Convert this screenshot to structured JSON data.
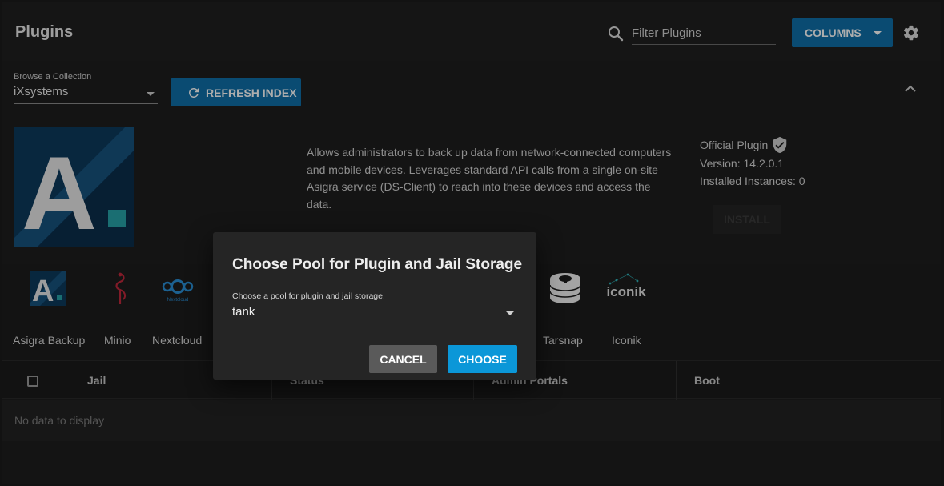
{
  "header": {
    "title": "Plugins",
    "filter_placeholder": "Filter Plugins",
    "columns_label": "COLUMNS"
  },
  "collection": {
    "label": "Browse a Collection",
    "value": "iXsystems",
    "refresh_label": "REFRESH INDEX"
  },
  "selected_plugin": {
    "description": "Allows administrators to back up data from network-connected computers and mobile devices. Leverages standard API calls from a single on-site Asigra service (DS-Client) to reach into these devices and access the data.",
    "official_label": "Official Plugin",
    "version": "Version: 14.2.0.1",
    "installed_instances": "Installed Instances: 0",
    "install_label": "INSTALL",
    "logo_letter": "A."
  },
  "plugins": [
    {
      "name": "Asigra Backup",
      "icon": "asigra-icon",
      "thumb_text": "A."
    },
    {
      "name": "Minio",
      "icon": "minio-icon",
      "thumb_text": ""
    },
    {
      "name": "Nextcloud",
      "icon": "nextcloud-icon",
      "thumb_text": "Nextcloud"
    },
    {
      "name": "Tarsnap",
      "icon": "tarsnap-icon",
      "thumb_text": ""
    },
    {
      "name": "Iconik",
      "icon": "iconik-icon",
      "thumb_text": "iconik"
    }
  ],
  "table": {
    "columns": [
      "Jail",
      "Status",
      "Admin Portals",
      "Boot"
    ],
    "empty_text": "No data to display"
  },
  "dialog": {
    "title": "Choose Pool for Plugin and Jail Storage",
    "pool_label": "Choose a pool for plugin and jail storage.",
    "pool_value": "tank",
    "cancel_label": "CANCEL",
    "choose_label": "CHOOSE"
  },
  "colors": {
    "primary": "#0f6fa8",
    "accent": "#0b97d8",
    "background": "#1e1e1e"
  }
}
